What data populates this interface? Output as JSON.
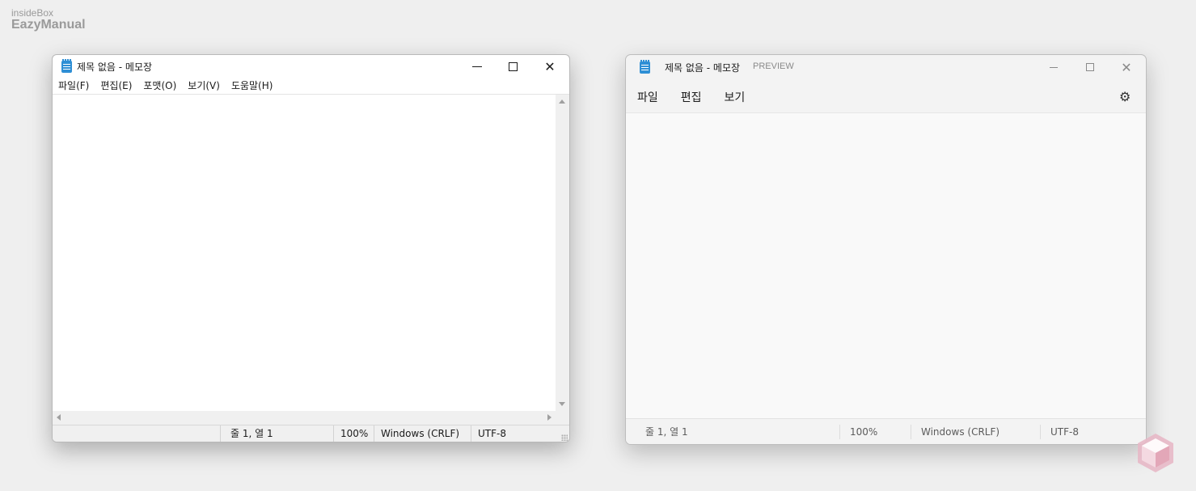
{
  "brand": {
    "line1": "insideBox",
    "line2": "EazyManual"
  },
  "classic": {
    "title": "제목 없음 - 메모장",
    "icon": "notepad-icon",
    "menu": [
      "파일(F)",
      "편집(E)",
      "포맷(O)",
      "보기(V)",
      "도움말(H)"
    ],
    "status": {
      "position": "줄 1, 열 1",
      "zoom": "100%",
      "line_ending": "Windows (CRLF)",
      "encoding": "UTF-8"
    },
    "content": ""
  },
  "modern": {
    "title": "제목 없음 - 메모장",
    "badge": "PREVIEW",
    "icon": "notepad-icon",
    "menu": [
      "파일",
      "편집",
      "보기"
    ],
    "status": {
      "position": "줄 1, 열 1",
      "zoom": "100%",
      "line_ending": "Windows (CRLF)",
      "encoding": "UTF-8"
    },
    "content": ""
  },
  "colors": {
    "accent": "#2f8fd5",
    "cube": "#e7b8c6"
  }
}
